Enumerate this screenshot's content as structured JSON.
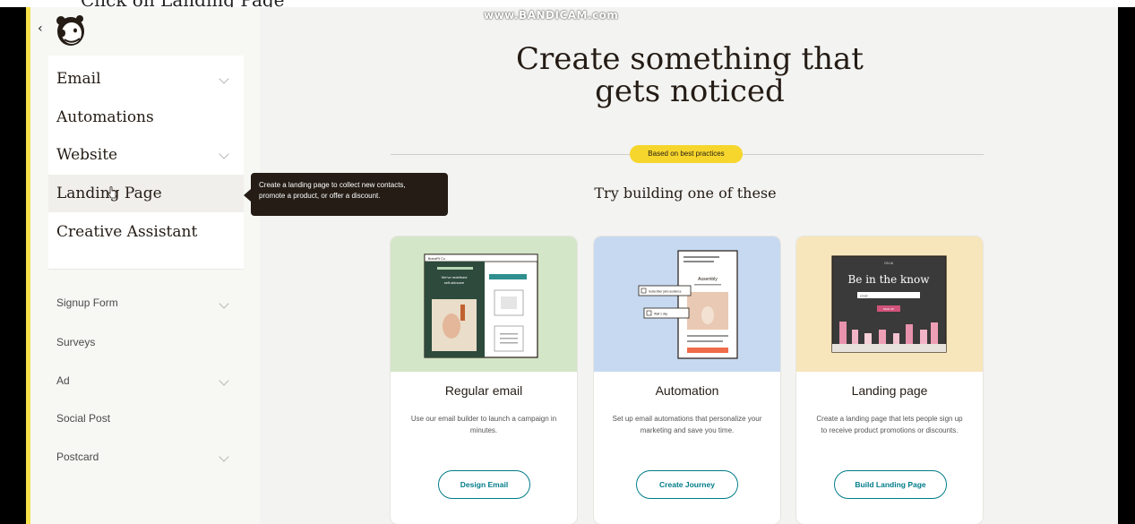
{
  "top_strip_text": "Click on Landing Page",
  "watermark": "www.BANDICAM.com",
  "sidebar": {
    "collapse_glyph": "‹",
    "logo_icon": "mailchimp-freddie-icon",
    "main_items": [
      {
        "label": "Email",
        "has_chevron": true
      },
      {
        "label": "Automations",
        "has_chevron": false
      },
      {
        "label": "Website",
        "has_chevron": true
      },
      {
        "label": "Landing Page",
        "has_chevron": false
      },
      {
        "label": "Creative Assistant",
        "has_chevron": false
      }
    ],
    "sub_items": [
      {
        "label": "Signup Form",
        "has_chevron": true
      },
      {
        "label": "Surveys",
        "has_chevron": false
      },
      {
        "label": "Ad",
        "has_chevron": true
      },
      {
        "label": "Social Post",
        "has_chevron": false
      },
      {
        "label": "Postcard",
        "has_chevron": true
      }
    ]
  },
  "tooltip": {
    "line1": "Create a landing page to collect new contacts,",
    "line2": "promote a product, or offer a discount."
  },
  "main": {
    "hero_line1": "Create something that",
    "hero_line2": "gets noticed",
    "badge": "Based on best practices",
    "subheading": "Try building one of these"
  },
  "cards": [
    {
      "title": "Regular email",
      "description": "Use our email builder to launch a campaign in minutes.",
      "button": "Design Email",
      "image_bg": "#d3e6c8",
      "preview": {
        "brand": "BrandFit Co.",
        "promo": "We've redefined self-skincare"
      }
    },
    {
      "title": "Automation",
      "description": "Set up email automations that personalize your marketing and save you time.",
      "button": "Create Journey",
      "image_bg": "#c7d9f0",
      "preview": {
        "heading": "Assembly",
        "chip1": "Subscriber joins audience",
        "chip2": "Wait 1 day"
      }
    },
    {
      "title": "Landing page",
      "description": "Create a landing page that lets people sign up to receive product promotions or discounts.",
      "button": "Build Landing Page",
      "image_bg": "#f7e6bb",
      "preview": {
        "headline": "Be in the know",
        "input": "email",
        "cta": "SIGN UP"
      }
    }
  ],
  "colors": {
    "accent_yellow": "#f6d62c",
    "teal": "#007c89",
    "ink": "#241c15"
  }
}
